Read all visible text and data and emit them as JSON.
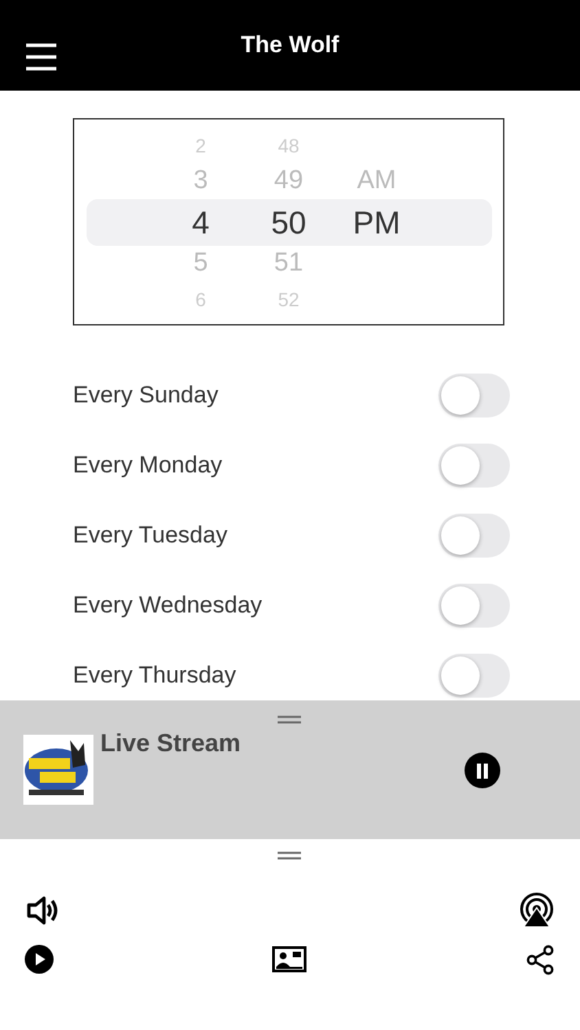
{
  "header": {
    "title": "The Wolf"
  },
  "time_picker": {
    "columns": [
      {
        "items": [
          {
            "label": "2",
            "selected": false
          },
          {
            "label": "3",
            "selected": false
          },
          {
            "label": "4",
            "selected": true
          },
          {
            "label": "5",
            "selected": false
          },
          {
            "label": "6",
            "selected": false
          }
        ]
      },
      {
        "items": [
          {
            "label": "48",
            "selected": false
          },
          {
            "label": "49",
            "selected": false
          },
          {
            "label": "50",
            "selected": true
          },
          {
            "label": "51",
            "selected": false
          },
          {
            "label": "52",
            "selected": false
          }
        ]
      },
      {
        "items": [
          {
            "label": "AM",
            "selected": false
          },
          {
            "label": "PM",
            "selected": true
          }
        ]
      }
    ]
  },
  "repeat_days": [
    {
      "label": "Every Sunday",
      "on": false
    },
    {
      "label": "Every Monday",
      "on": false
    },
    {
      "label": "Every Tuesday",
      "on": false
    },
    {
      "label": "Every Wednesday",
      "on": false
    },
    {
      "label": "Every Thursday",
      "on": false
    }
  ],
  "mini_player": {
    "title": "Live Stream",
    "playing": true
  },
  "player_bar": {
    "playing": false
  }
}
